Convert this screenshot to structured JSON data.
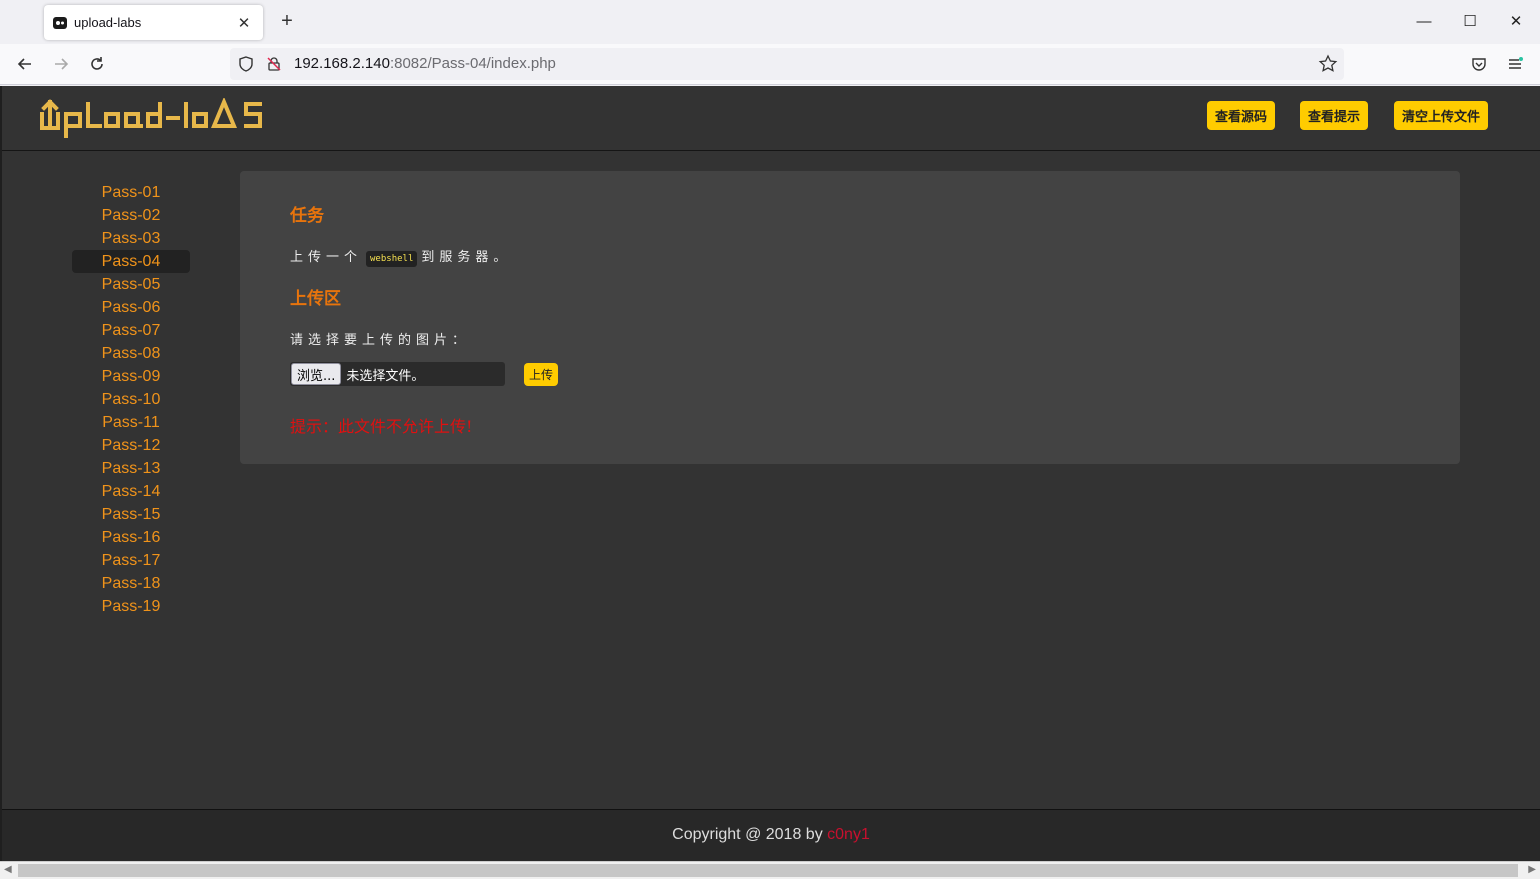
{
  "browser": {
    "tab_title": "upload-labs",
    "tab_close": "✕",
    "new_tab": "+",
    "url_host": "192.168.2.140",
    "url_rest": ":8082/Pass-04/index.php",
    "window_controls": {
      "minimize": "—",
      "maximize": "☐",
      "close": "✕"
    }
  },
  "header": {
    "logo_text": "UpLoad-labs",
    "buttons": [
      "查看源码",
      "查看提示",
      "清空上传文件"
    ]
  },
  "sidebar": {
    "items": [
      "Pass-01",
      "Pass-02",
      "Pass-03",
      "Pass-04",
      "Pass-05",
      "Pass-06",
      "Pass-07",
      "Pass-08",
      "Pass-09",
      "Pass-10",
      "Pass-11",
      "Pass-12",
      "Pass-13",
      "Pass-14",
      "Pass-15",
      "Pass-16",
      "Pass-17",
      "Pass-18",
      "Pass-19"
    ],
    "active": "Pass-04"
  },
  "panel": {
    "task_title": "任务",
    "task_text_before": "上传一个",
    "task_code": "webshell",
    "task_text_after": "到服务器。",
    "upload_title": "上传区",
    "upload_prompt": "请选择要上传的图片：",
    "browse_label": "浏览...",
    "no_file": "未选择文件。",
    "upload_button": "上传",
    "hint": "提示：此文件不允许上传!"
  },
  "footer": {
    "copyright": "Copyright @ 2018 by ",
    "author": "c0ny1"
  },
  "colors": {
    "accent": "#ffcc00",
    "link": "#f0931a",
    "title": "#e8740c",
    "error": "#e01010",
    "page_bg": "#333333"
  }
}
